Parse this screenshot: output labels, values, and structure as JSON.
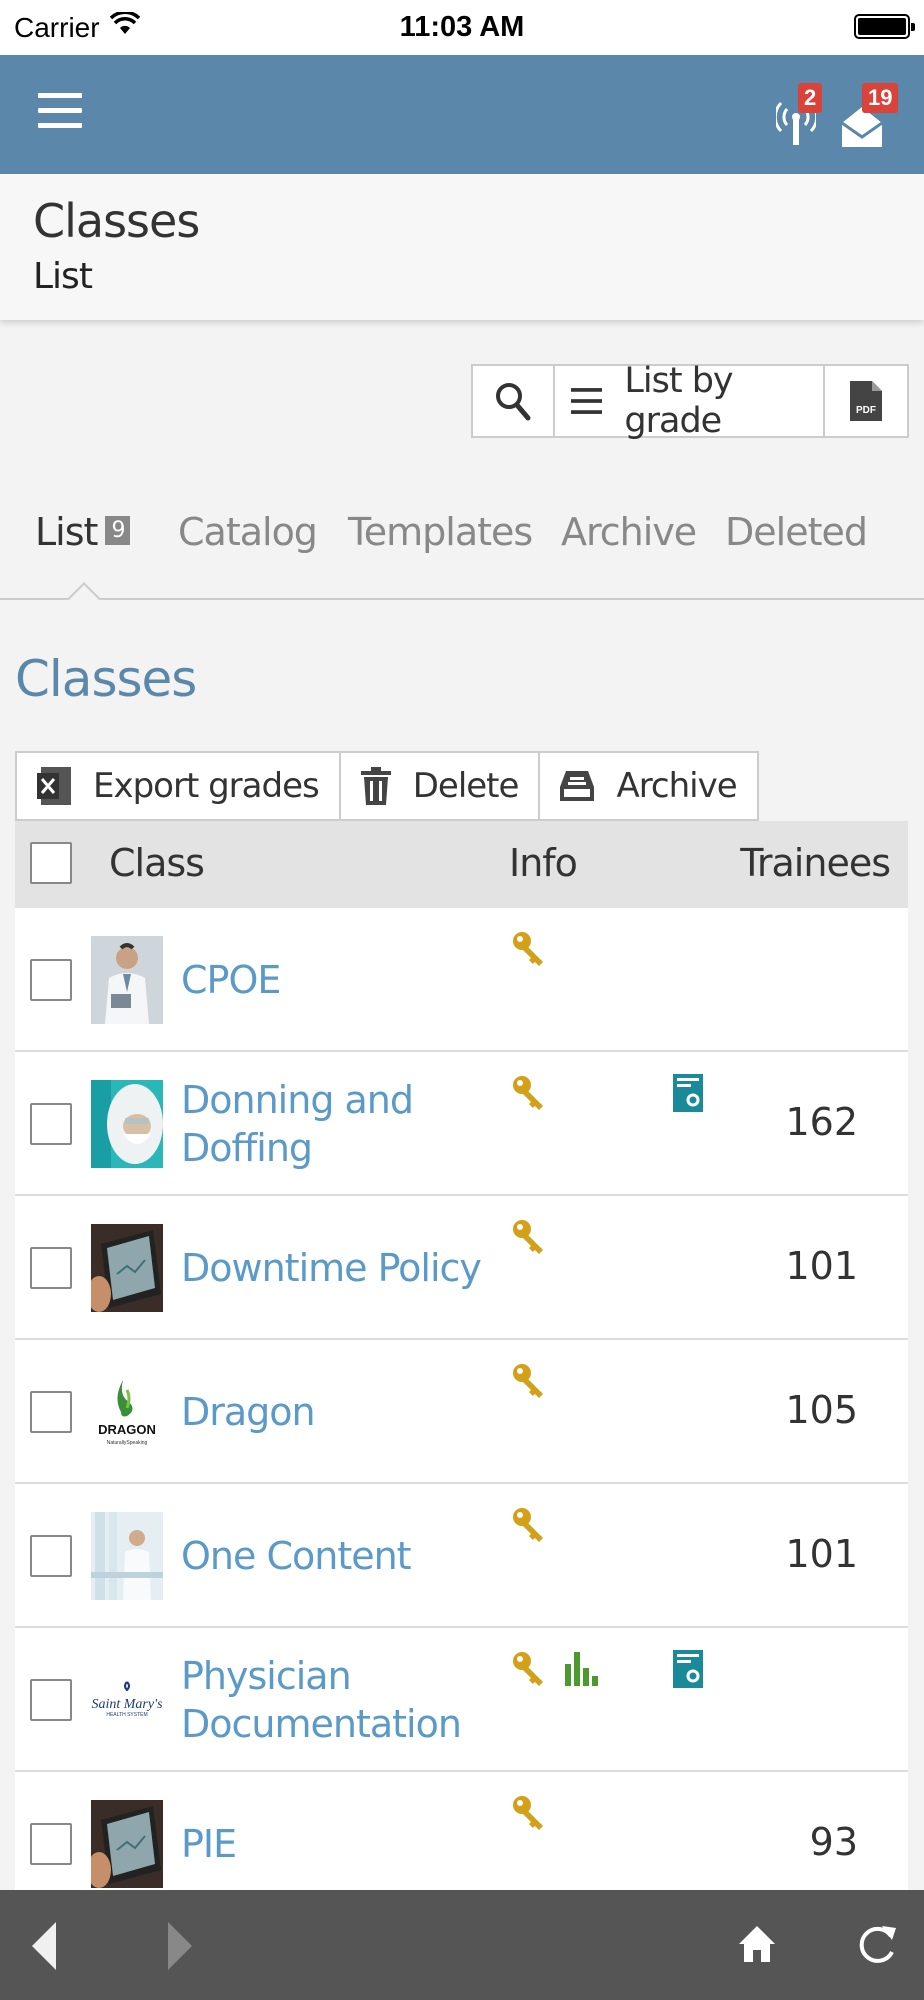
{
  "status": {
    "carrier": "Carrier",
    "time": "11:03 AM"
  },
  "header": {
    "signal_badge": "2",
    "mail_badge": "19"
  },
  "page": {
    "title": "Classes",
    "subtitle": "List"
  },
  "toolbar": {
    "grade_label": "List by grade",
    "pdf_label": "PDF"
  },
  "tabs": [
    {
      "label": "List",
      "count": "9"
    },
    {
      "label": "Catalog"
    },
    {
      "label": "Templates"
    },
    {
      "label": "Archive"
    },
    {
      "label": "Deleted"
    }
  ],
  "section_title": "Classes",
  "actions": {
    "export": "Export grades",
    "delete": "Delete",
    "archive": "Archive"
  },
  "table": {
    "columns": [
      "Class",
      "Info",
      "Trainees"
    ],
    "rows": [
      {
        "name": "CPOE",
        "trainees": "",
        "key": true,
        "stats": false,
        "book": false
      },
      {
        "name": "Donning and Doffing",
        "trainees": "162",
        "key": true,
        "stats": false,
        "book": true
      },
      {
        "name": "Downtime Policy",
        "trainees": "101",
        "key": true,
        "stats": false,
        "book": false
      },
      {
        "name": "Dragon",
        "trainees": "105",
        "key": true,
        "stats": false,
        "book": false
      },
      {
        "name": "One Content",
        "trainees": "101",
        "key": true,
        "stats": false,
        "book": false
      },
      {
        "name": "Physician Documentation",
        "trainees": "",
        "key": true,
        "stats": true,
        "book": true
      },
      {
        "name": "PIE",
        "trainees": "93",
        "key": true,
        "stats": false,
        "book": false
      }
    ]
  },
  "thumb_text": {
    "dragon": "DRAGON",
    "dragon_sub": "NaturallySpeaking",
    "stmary": "Saint Mary's",
    "stmary_sub": "HEALTH SYSTEM"
  },
  "colors": {
    "header": "#5b87aa",
    "link": "#5b9ac8",
    "key": "#d4a017",
    "stats": "#4a9a2e",
    "book": "#1a8a9a",
    "badge": "#d9433a"
  }
}
